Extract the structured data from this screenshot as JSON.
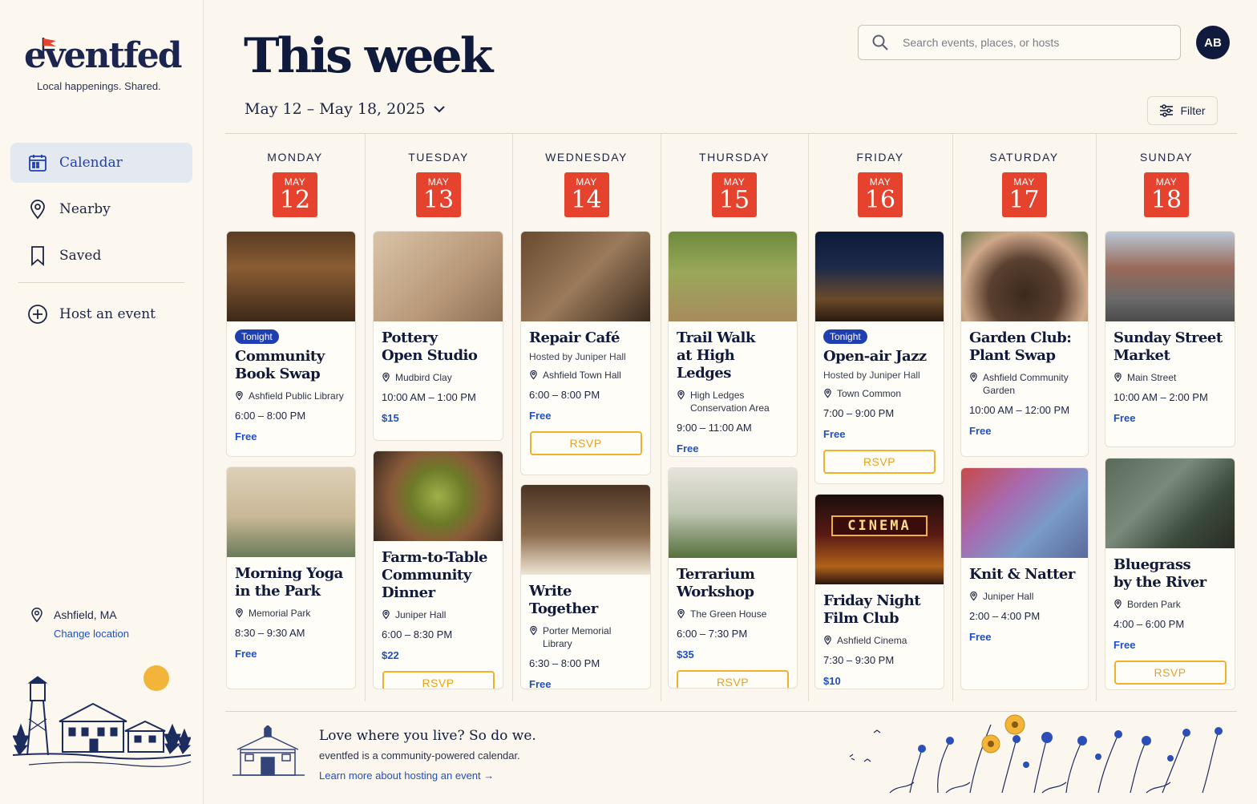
{
  "app": {
    "logo": "eventfed",
    "tagline": "Local happenings. Shared."
  },
  "sidebar": {
    "items": [
      {
        "label": "Calendar",
        "icon": "calendar-icon",
        "active": true
      },
      {
        "label": "Nearby",
        "icon": "map-pin-icon",
        "active": false
      },
      {
        "label": "Saved",
        "icon": "bookmark-icon",
        "active": false
      },
      {
        "label": "Host an event",
        "icon": "plus-circle-icon",
        "active": false
      }
    ],
    "location": {
      "name": "Ashfield, MA",
      "change_label": "Change location"
    }
  },
  "header": {
    "title": "This week",
    "date_range": "May 12 – May 18, 2025",
    "search_placeholder": "Search events, places, or hosts",
    "avatar_initials": "AB",
    "filter_label": "Filter"
  },
  "colors": {
    "accent": "#1f3fb0",
    "date_badge": "#e5432e",
    "rsvp": "#f2b12a",
    "price": "#1f4fc4"
  },
  "days": [
    {
      "name": "MONDAY",
      "month": "MAY",
      "date": "12",
      "events": [
        {
          "tag": "Tonight",
          "title": "Community Book Swap",
          "host": "",
          "place": "Ashfield Public Library",
          "time": "6:00 – 8:00 PM",
          "price": "Free",
          "rsvp": "",
          "image": "book-swap-photo"
        },
        {
          "tag": "",
          "title": "Morning Yoga in the Park",
          "host": "",
          "place": "Memorial Park",
          "time": "8:30 – 9:30 AM",
          "price": "Free",
          "rsvp": "",
          "image": "yoga-photo"
        }
      ]
    },
    {
      "name": "TUESDAY",
      "month": "MAY",
      "date": "13",
      "events": [
        {
          "tag": "",
          "title": "Pottery Open Studio",
          "host": "",
          "place": "Mudbird Clay",
          "time": "10:00 AM – 1:00 PM",
          "price": "$15",
          "rsvp": "",
          "image": "pottery-photo"
        },
        {
          "tag": "",
          "title": "Farm-to-Table Community Dinner",
          "host": "",
          "place": "Juniper Hall",
          "time": "6:00 – 8:30 PM",
          "price": "$22",
          "rsvp": "RSVP",
          "image": "salad-photo"
        }
      ]
    },
    {
      "name": "WEDNESDAY",
      "month": "MAY",
      "date": "14",
      "events": [
        {
          "tag": "",
          "title": "Repair Café",
          "host": "Hosted by Juniper Hall",
          "place": "Ashfield Town Hall",
          "time": "6:00 – 8:00 PM",
          "price": "Free",
          "rsvp": "RSVP",
          "image": "repair-photo"
        },
        {
          "tag": "",
          "title": "Write Together",
          "host": "",
          "place": "Porter Memorial Library",
          "time": "6:30 – 8:00 PM",
          "price": "Free",
          "rsvp": "",
          "image": "writing-photo"
        }
      ]
    },
    {
      "name": "THURSDAY",
      "month": "MAY",
      "date": "15",
      "events": [
        {
          "tag": "",
          "title": "Trail Walk at High Ledges",
          "host": "",
          "place": "High Ledges Conservation Area",
          "time": "9:00 – 11:00 AM",
          "price": "Free",
          "rsvp": "",
          "image": "trail-photo"
        },
        {
          "tag": "",
          "title": "Terrarium Workshop",
          "host": "",
          "place": "The Green House",
          "time": "6:00 – 7:30 PM",
          "price": "$35",
          "rsvp": "RSVP",
          "image": "terrarium-photo"
        }
      ]
    },
    {
      "name": "FRIDAY",
      "month": "MAY",
      "date": "16",
      "events": [
        {
          "tag": "Tonight",
          "title": "Open-air Jazz",
          "host": "Hosted by Juniper Hall",
          "place": "Town Common",
          "time": "7:00 – 9:00 PM",
          "price": "Free",
          "rsvp": "RSVP",
          "image": "jazz-photo"
        },
        {
          "tag": "",
          "title": "Friday Night Film Club",
          "host": "",
          "place": "Ashfield Cinema",
          "time": "7:30 – 9:30 PM",
          "price": "$10",
          "rsvp": "",
          "image": "cinema-photo",
          "sign": "CINEMA"
        }
      ]
    },
    {
      "name": "SATURDAY",
      "month": "MAY",
      "date": "17",
      "events": [
        {
          "tag": "",
          "title": "Garden Club: Plant Swap",
          "host": "",
          "place": "Ashfield Community Garden",
          "time": "10:00 AM – 12:00 PM",
          "price": "Free",
          "rsvp": "",
          "image": "seedling-photo"
        },
        {
          "tag": "",
          "title": "Knit & Natter",
          "host": "",
          "place": "Juniper Hall",
          "time": "2:00 – 4:00 PM",
          "price": "Free",
          "rsvp": "",
          "image": "yarn-photo"
        }
      ]
    },
    {
      "name": "SUNDAY",
      "month": "MAY",
      "date": "18",
      "events": [
        {
          "tag": "",
          "title": "Sunday Street Market",
          "host": "",
          "place": "Main Street",
          "time": "10:00 AM – 2:00 PM",
          "price": "Free",
          "rsvp": "",
          "image": "market-photo"
        },
        {
          "tag": "",
          "title": "Bluegrass by the River",
          "host": "",
          "place": "Borden Park",
          "time": "4:00 – 6:00 PM",
          "price": "Free",
          "rsvp": "RSVP",
          "image": "guitar-photo"
        }
      ]
    }
  ],
  "footer": {
    "title": "Love where you live? So do we.",
    "subtitle": "eventfed is a community-powered calendar.",
    "link": "Learn more about hosting an event →"
  }
}
